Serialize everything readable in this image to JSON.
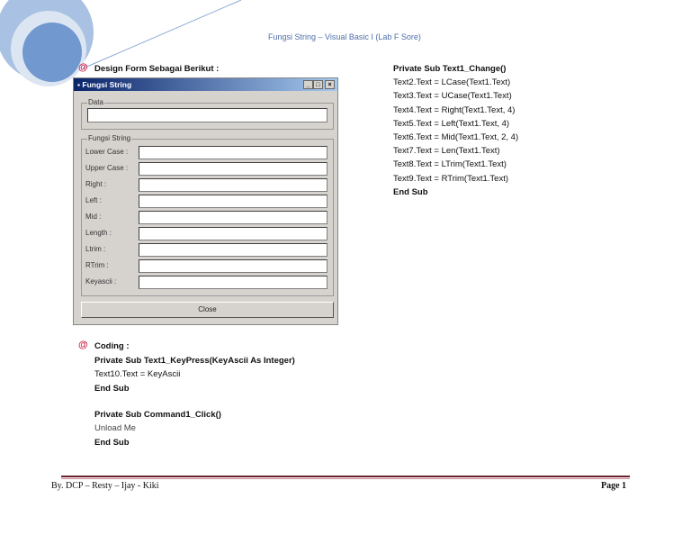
{
  "header": {
    "title": "Fungsi String – Visual Basic I (Lab F Sore)"
  },
  "section1": {
    "bullet": "@",
    "heading": "Design Form Sebagai Berikut :"
  },
  "form": {
    "title": "Fungsi String",
    "title_buttons": [
      "_",
      "□",
      "×"
    ],
    "data_group": "Data",
    "fungsi_group": "Fungsi String",
    "fields": [
      {
        "label": "Lower Case :",
        "value": ""
      },
      {
        "label": "Upper Case :",
        "value": ""
      },
      {
        "label": "Right :",
        "value": ""
      },
      {
        "label": "Left :",
        "value": ""
      },
      {
        "label": "Mid :",
        "value": ""
      },
      {
        "label": "Length :",
        "value": ""
      },
      {
        "label": "Ltrim :",
        "value": ""
      },
      {
        "label": "RTrim :",
        "value": ""
      },
      {
        "label": "Keyascii :",
        "value": ""
      }
    ],
    "close_label": "Close"
  },
  "code_right": [
    "Private Sub Text1_Change()",
    "Text2.Text = LCase(Text1.Text)",
    "Text3.Text = UCase(Text1.Text)",
    "Text4.Text = Right(Text1.Text, 4)",
    "Text5.Text = Left(Text1.Text, 4)",
    "Text6.Text = Mid(Text1.Text, 2, 4)",
    "Text7.Text = Len(Text1.Text)",
    "Text8.Text = LTrim(Text1.Text)",
    "Text9.Text = RTrim(Text1.Text)",
    "End Sub"
  ],
  "section2": {
    "bullet": "@",
    "heading": "Coding :"
  },
  "code_bottom": [
    "Private Sub Text1_KeyPress(KeyAscii As Integer)",
    "Text10.Text = KeyAscii",
    "End Sub",
    "Private Sub Command1_Click()",
    "Unload Me",
    "End Sub"
  ],
  "footer": {
    "authors": "By. DCP – Resty – Ijay - Kiki",
    "page": "Page 1"
  }
}
